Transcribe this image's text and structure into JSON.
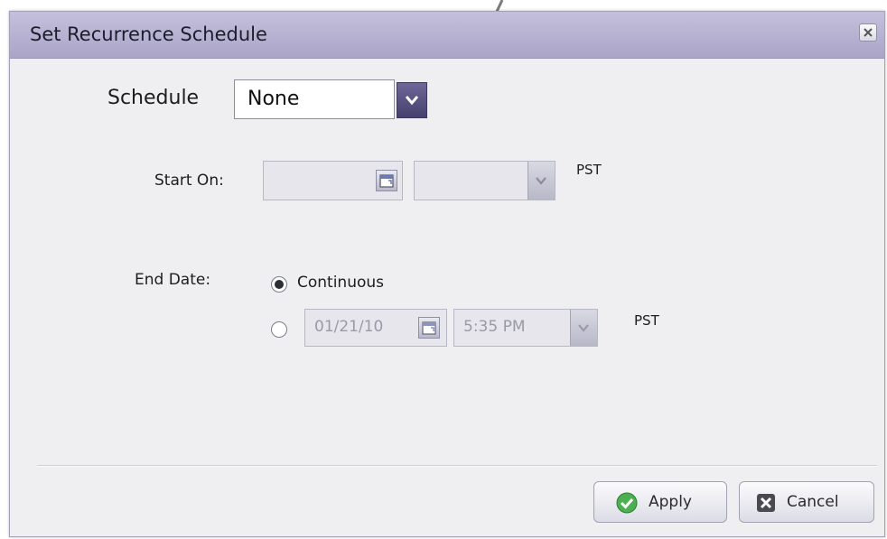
{
  "dialog": {
    "title": "Set Recurrence Schedule",
    "close_icon": "close-icon"
  },
  "schedule": {
    "label": "Schedule",
    "value": "None",
    "dropdown_icon": "chevron-down-icon"
  },
  "start_on": {
    "label": "Start On:",
    "date_value": "",
    "time_value": "",
    "timezone": "PST",
    "calendar_icon": "calendar-icon",
    "dropdown_icon": "chevron-down-icon"
  },
  "end_date": {
    "label": "End Date:",
    "continuous_label": "Continuous",
    "continuous_selected": true,
    "date_value": "01/21/10",
    "time_value": "5:35 PM",
    "timezone": "PST",
    "calendar_icon": "calendar-icon",
    "dropdown_icon": "chevron-down-icon"
  },
  "buttons": {
    "apply_label": "Apply",
    "apply_icon": "check-circle-icon",
    "cancel_label": "Cancel",
    "cancel_icon": "cancel-icon"
  },
  "colors": {
    "titlebar": "#b5b1d2",
    "schedule_dropdown": "#554e80",
    "apply_icon": "#4caf50"
  }
}
